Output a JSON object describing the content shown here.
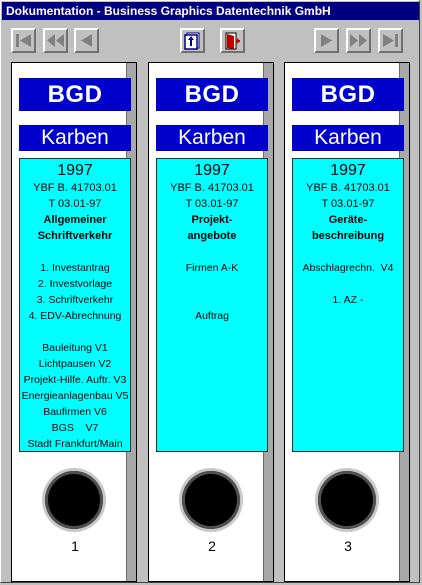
{
  "window": {
    "title": "Dokumentation - Business Graphics Datentechnik GmbH"
  },
  "toolbar": {
    "buttons": [
      {
        "name": "first-page-button",
        "icon": "first-page-icon"
      },
      {
        "name": "rewind-button",
        "icon": "rewind-icon"
      },
      {
        "name": "previous-button",
        "icon": "previous-icon"
      },
      {
        "name": "index-button",
        "icon": "index-icon"
      },
      {
        "name": "exit-button",
        "icon": "exit-door-icon"
      },
      {
        "name": "next-button",
        "icon": "next-icon"
      },
      {
        "name": "fast-forward-button",
        "icon": "fast-forward-icon"
      },
      {
        "name": "last-page-button",
        "icon": "last-page-icon"
      }
    ]
  },
  "colors": {
    "brand_blue": "#0000cc",
    "panel_cyan": "#00ffff",
    "title_bar": "#000080"
  },
  "binders": [
    {
      "brand": "BGD",
      "client": "Karben",
      "year": "1997",
      "ref": "YBF B. 41703.01",
      "date": "T 03.01-97",
      "subject_lines": [
        "Allgemeiner",
        "Schriftverkehr"
      ],
      "items": [
        "",
        "1. Investantrag",
        "2. Investvorlage",
        "3. Schriftverkehr",
        "4. EDV-Abrechnung",
        "",
        "Bauleitung V1",
        "Lichtpausen V2",
        "Projekt-Hilfe. Auftr. V3",
        "Energieanlagenbau V5",
        "Baufirmen V6",
        "BGS    V7",
        "Stadt Frankfurt/Main"
      ],
      "number": "1"
    },
    {
      "brand": "BGD",
      "client": "Karben",
      "year": "1997",
      "ref": "YBF B. 41703.01",
      "date": "T 03.01-97",
      "subject_lines": [
        "Projekt-",
        "angebote"
      ],
      "items": [
        "",
        "Firmen A-K",
        "",
        "",
        "Auftrag"
      ],
      "number": "2"
    },
    {
      "brand": "BGD",
      "client": "Karben",
      "year": "1997",
      "ref": "YBF B. 41703.01",
      "date": "T 03.01-97",
      "subject_lines": [
        "Geräte-",
        "beschreibung"
      ],
      "items": [
        "",
        "Abschlagrechn.  V4",
        "",
        "1. AZ -"
      ],
      "number": "3"
    }
  ]
}
